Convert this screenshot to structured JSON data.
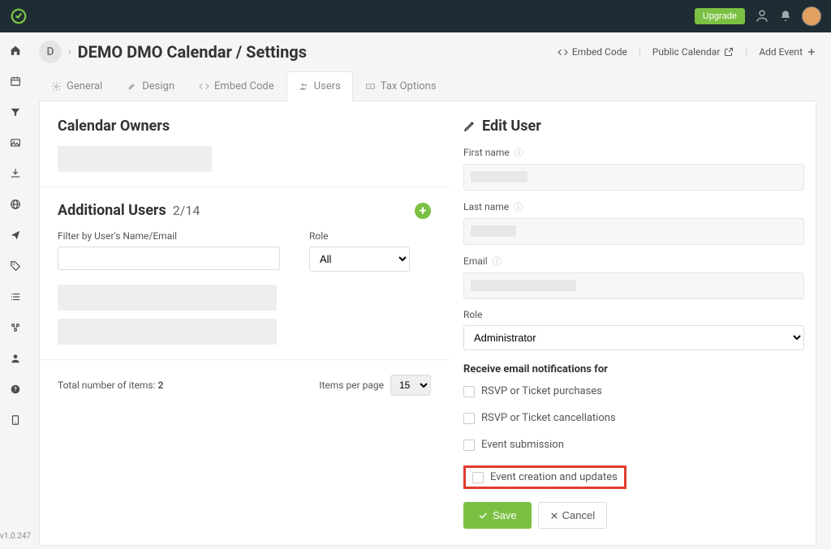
{
  "topbar": {
    "upgrade_label": "Upgrade"
  },
  "sidebar": {
    "version": "v1.0.247"
  },
  "header": {
    "org_initial": "D",
    "title": "DEMO DMO Calendar / Settings",
    "links": {
      "embed_code": "Embed Code",
      "public_calendar": "Public Calendar",
      "add_event": "Add Event"
    }
  },
  "tabs": {
    "general": "General",
    "design": "Design",
    "embed_code": "Embed Code",
    "users": "Users",
    "tax_options": "Tax Options"
  },
  "left": {
    "owners_title": "Calendar Owners",
    "additional_title": "Additional Users",
    "additional_count": "2/14",
    "filter_name_label": "Filter by User's Name/Email",
    "role_label": "Role",
    "role_all": "All",
    "total_label": "Total number of items: ",
    "total_value": "2",
    "items_per_page_label": "Items per page",
    "items_per_page_value": "15"
  },
  "right": {
    "title": "Edit User",
    "first_name_label": "First name",
    "last_name_label": "Last name",
    "email_label": "Email",
    "role_label": "Role",
    "role_value": "Administrator",
    "notifications_title": "Receive email notifications for",
    "cb_rsvp_purchases": "RSVP or Ticket purchases",
    "cb_rsvp_cancellations": "RSVP or Ticket cancellations",
    "cb_event_submission": "Event submission",
    "cb_event_creation": "Event creation and updates",
    "save_label": "Save",
    "cancel_label": "Cancel"
  }
}
